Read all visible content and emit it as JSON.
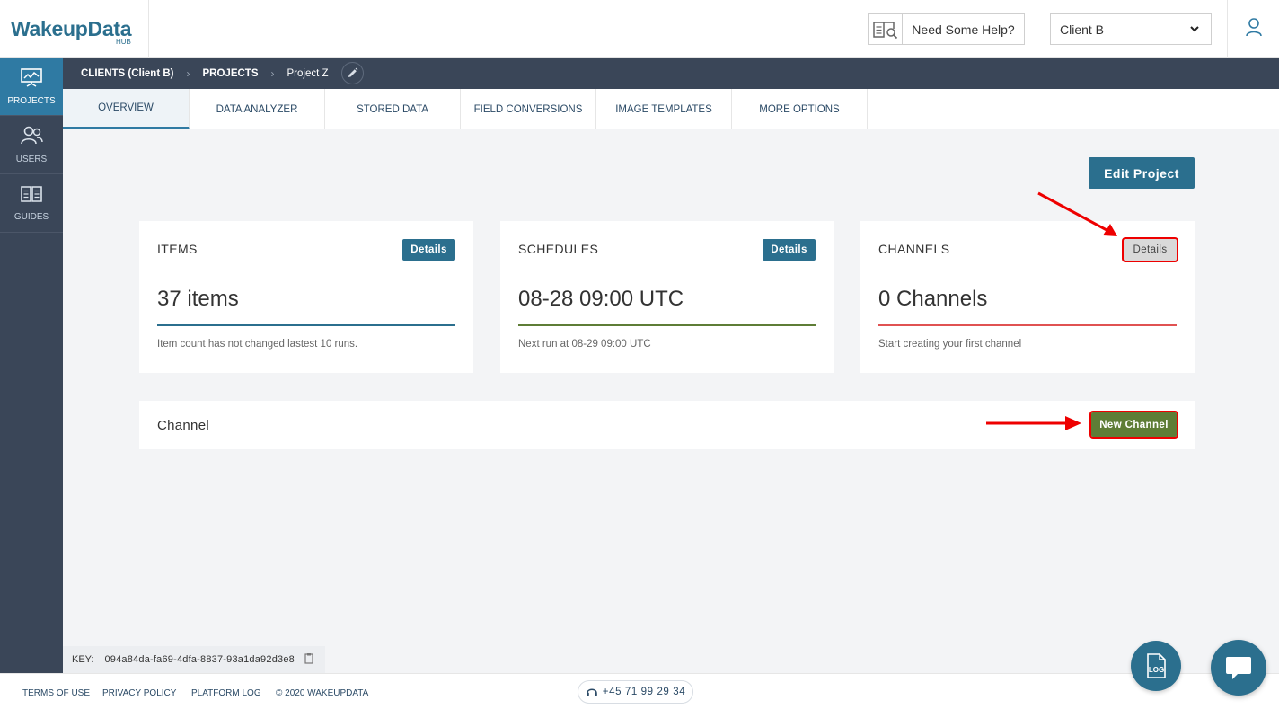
{
  "header": {
    "logo_text": "WakeupData",
    "logo_sub": "HUB",
    "help_label": "Need Some Help?",
    "client_selected": "Client B"
  },
  "sidebar": {
    "items": [
      {
        "label": "PROJECTS",
        "icon": "presentation-chart-icon",
        "active": true
      },
      {
        "label": "USERS",
        "icon": "users-icon",
        "active": false
      },
      {
        "label": "GUIDES",
        "icon": "book-icon",
        "active": false
      }
    ]
  },
  "breadcrumb": {
    "items": [
      "CLIENTS (Client B)",
      "PROJECTS"
    ],
    "current": "Project Z"
  },
  "tabs": [
    "OVERVIEW",
    "DATA ANALYZER",
    "STORED DATA",
    "FIELD CONVERSIONS",
    "IMAGE TEMPLATES",
    "MORE OPTIONS"
  ],
  "main": {
    "edit_project_label": "Edit Project",
    "cards": [
      {
        "title": "ITEMS",
        "details_label": "Details",
        "value": "37 items",
        "note": "Item count has not changed lastest 10 runs.",
        "line_color": "#2b6f8e"
      },
      {
        "title": "SCHEDULES",
        "details_label": "Details",
        "value": "08-28 09:00 UTC",
        "note": "Next run at 08-29 09:00 UTC",
        "line_color": "#5e7d36"
      },
      {
        "title": "CHANNELS",
        "details_label": "Details",
        "value": "0 Channels",
        "note": "Start creating your first channel",
        "line_color": "#e05252"
      }
    ],
    "channel_title": "Channel",
    "new_channel_label": "New Channel"
  },
  "keybar": {
    "label": "KEY:",
    "value": "094a84da-fa69-4dfa-8837-93a1da92d3e8"
  },
  "footer": {
    "links": [
      "TERMS OF USE",
      "PRIVACY POLICY",
      "PLATFORM LOG",
      "© 2020 WAKEUPDATA"
    ],
    "phone": "+45 71 99 29 34"
  },
  "floating": {
    "log_label": "LOG"
  },
  "colors": {
    "brand": "#2b6f8e",
    "sidebar": "#3a4658",
    "success": "#5e7d36",
    "annotation": "#ee0000"
  }
}
